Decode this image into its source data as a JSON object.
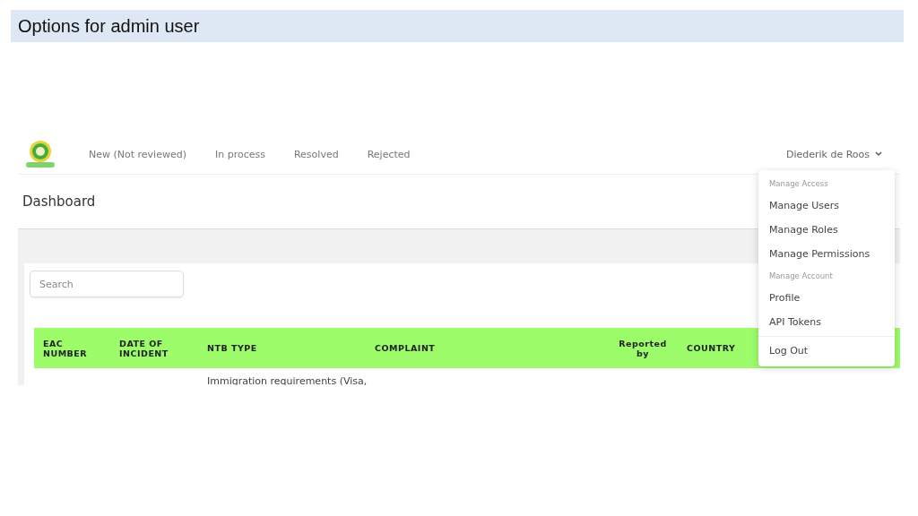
{
  "slide": {
    "title": "Options for admin user"
  },
  "nav": {
    "items": [
      "New (Not reviewed)",
      "In process",
      "Resolved",
      "Rejected"
    ],
    "user": "Diederik de Roos"
  },
  "page": {
    "title": "Dashboard"
  },
  "search": {
    "placeholder": "Search"
  },
  "table": {
    "columns": [
      "EAC\nNUMBER",
      "DATE OF\nINCIDENT",
      "NTB TYPE",
      "COMPLAINT",
      "Reported\nby",
      "COUNTRY"
    ],
    "rows": [
      {
        "ntb_type": "Immigration requirements (Visa,"
      }
    ]
  },
  "menu": {
    "items": [
      {
        "kind": "header",
        "label": "Manage Access"
      },
      {
        "kind": "item",
        "label": "Manage Users"
      },
      {
        "kind": "item",
        "label": "Manage Roles"
      },
      {
        "kind": "item",
        "label": "Manage Permissions"
      },
      {
        "kind": "header",
        "label": "Manage Account"
      },
      {
        "kind": "item",
        "label": "Profile"
      },
      {
        "kind": "item",
        "label": "API Tokens"
      },
      {
        "kind": "divider"
      },
      {
        "kind": "item",
        "label": "Log Out"
      }
    ]
  }
}
